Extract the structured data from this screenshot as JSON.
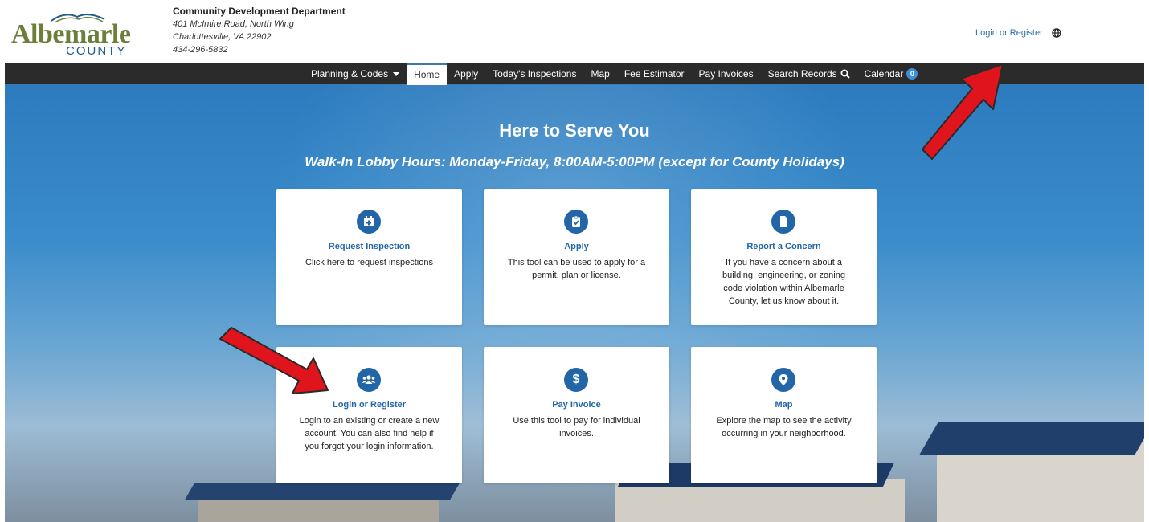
{
  "header": {
    "logo_name": "Albemarle",
    "logo_county": "COUNTY",
    "dept_name": "Community Development Department",
    "address_line1": "401 McIntire Road, North Wing",
    "address_line2": "Charlottesville, VA 22902",
    "phone": "434-296-5832",
    "login_link": "Login or Register"
  },
  "nav": {
    "items": [
      {
        "label": "Planning & Codes"
      },
      {
        "label": "Home"
      },
      {
        "label": "Apply"
      },
      {
        "label": "Today's Inspections"
      },
      {
        "label": "Map"
      },
      {
        "label": "Fee Estimator"
      },
      {
        "label": "Pay Invoices"
      },
      {
        "label": "Search Records"
      },
      {
        "label": "Calendar"
      }
    ],
    "calendar_badge": "0"
  },
  "hero": {
    "title": "Here to Serve You",
    "subtitle": "Walk-In Lobby Hours: Monday-Friday, 8:00AM-5:00PM (except for County Holidays)"
  },
  "cards": [
    {
      "title": "Request Inspection",
      "desc": "Click here to request inspections",
      "icon": "calendar-plus-icon"
    },
    {
      "title": "Apply",
      "desc": "This tool can be used to apply for a permit, plan or license.",
      "icon": "clipboard-check-icon"
    },
    {
      "title": "Report a Concern",
      "desc": "If you have a concern about a building, engineering, or zoning code violation within Albemarle County, let us know about it.",
      "icon": "document-icon"
    },
    {
      "title": "Login or Register",
      "desc": "Login to an existing or create a new account. You can also find help if you forgot your login information.",
      "icon": "users-icon"
    },
    {
      "title": "Pay Invoice",
      "desc": "Use this tool to pay for individual invoices.",
      "icon": "dollar-icon"
    },
    {
      "title": "Map",
      "desc": "Explore the map to see the activity occurring in your neighborhood.",
      "icon": "map-marker-icon"
    }
  ],
  "colors": {
    "brand_green": "#6b7f3a",
    "brand_blue": "#2266a8",
    "nav_bg": "#2b2b2b",
    "arrow_red": "#e0141c"
  }
}
